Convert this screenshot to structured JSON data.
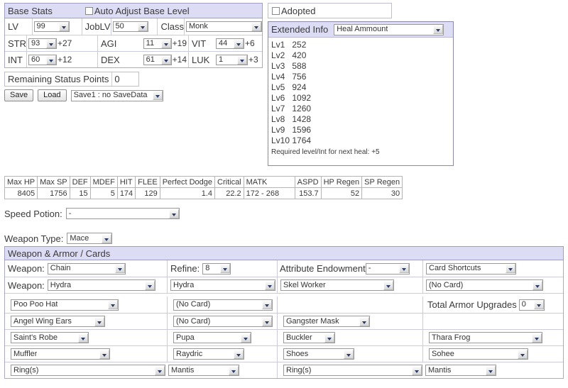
{
  "base_stats": {
    "title": "Base Stats",
    "auto_adjust_label": "Auto Adjust Base Level",
    "auto_adjust_checked": false,
    "rows": [
      {
        "n1": "LV",
        "v1": "99",
        "p1": "",
        "n2": "JobLV",
        "v2": "50",
        "p2": "",
        "n3": "Class",
        "v3": "Monk",
        "p3": ""
      },
      {
        "n1": "STR",
        "v1": "93",
        "p1": "+27",
        "n2": "AGI",
        "v2": "11",
        "p2": "+19",
        "n3": "VIT",
        "v3": "44",
        "p3": "+6"
      },
      {
        "n1": "INT",
        "v1": "60",
        "p1": "+12",
        "n2": "DEX",
        "v2": "61",
        "p2": "+14",
        "n3": "LUK",
        "v3": "1",
        "p3": "+3"
      }
    ],
    "remaining_label": "Remaining Status Points",
    "remaining_value": "0",
    "save_label": "Save",
    "load_label": "Load",
    "save_slot": "Save1 : no SaveData"
  },
  "adopted": {
    "label": "Adopted",
    "checked": false
  },
  "extended_info": {
    "title": "Extended Info",
    "selected": "Heal Ammount",
    "lines": [
      "Lv1   252",
      "Lv2   420",
      "Lv3   588",
      "Lv4   756",
      "Lv5   924",
      "Lv6   1092",
      "Lv7   1260",
      "Lv8   1428",
      "Lv9   1596",
      "Lv10 1764"
    ],
    "note": "Required level/Int for next heal: +5"
  },
  "stats_table": {
    "headers": [
      "Max HP",
      "Max SP",
      "DEF",
      "MDEF",
      "HIT",
      "FLEE",
      "Perfect Dodge",
      "Critical",
      "MATK",
      "ASPD",
      "HP Regen",
      "SP Regen"
    ],
    "values": [
      "8405",
      "1756",
      "15",
      "5",
      "174",
      "129",
      "1.4",
      "22.2",
      "172 - 268",
      "153.7",
      "52",
      "30"
    ],
    "align": [
      "right",
      "right",
      "right",
      "right",
      "right",
      "right",
      "right",
      "right",
      "left",
      "right",
      "right",
      "right"
    ]
  },
  "speed_potion": {
    "label": "Speed Potion:",
    "value": "-"
  },
  "weapon_type": {
    "label": "Weapon Type:",
    "value": "Mace"
  },
  "weapon_armor_cards": {
    "title": "Weapon & Armor / Cards",
    "row1": {
      "weapon_label": "Weapon:",
      "weapon_value": "Chain",
      "refine_label": "Refine:",
      "refine_value": "8",
      "attribute_label": "Attribute Endowment",
      "attribute_value": "-",
      "card_shortcuts_value": "Card Shortcuts"
    },
    "row2": {
      "weapon_label": "Weapon:",
      "card1": "Hydra",
      "card2": "Hydra",
      "card3": "Skel Worker",
      "card4": "(No Card)"
    },
    "row3": {
      "slot": "Poo Poo Hat",
      "card": "(No Card)",
      "armor_upgrades_label": "Total Armor Upgrades",
      "armor_upgrades_value": "0"
    },
    "row4": {
      "slot": "Angel Wing Ears",
      "card": "(No Card)",
      "slot2": "Gangster Mask"
    },
    "row5": {
      "slot": "Saint's Robe",
      "card": "Pupa",
      "slot2": "Buckler",
      "card2": "Thara Frog"
    },
    "row6": {
      "slot": "Muffler",
      "card": "Raydric",
      "slot2": "Shoes",
      "card2": "Sohee"
    },
    "row7": {
      "slot": "Ring(s)",
      "card": "Mantis",
      "slot2": "Ring(s)",
      "card2": "Mantis"
    }
  },
  "colors": {
    "header_bg": "#dcdcf5",
    "border": "#a9a9c9",
    "text": "#3a3a3a"
  }
}
